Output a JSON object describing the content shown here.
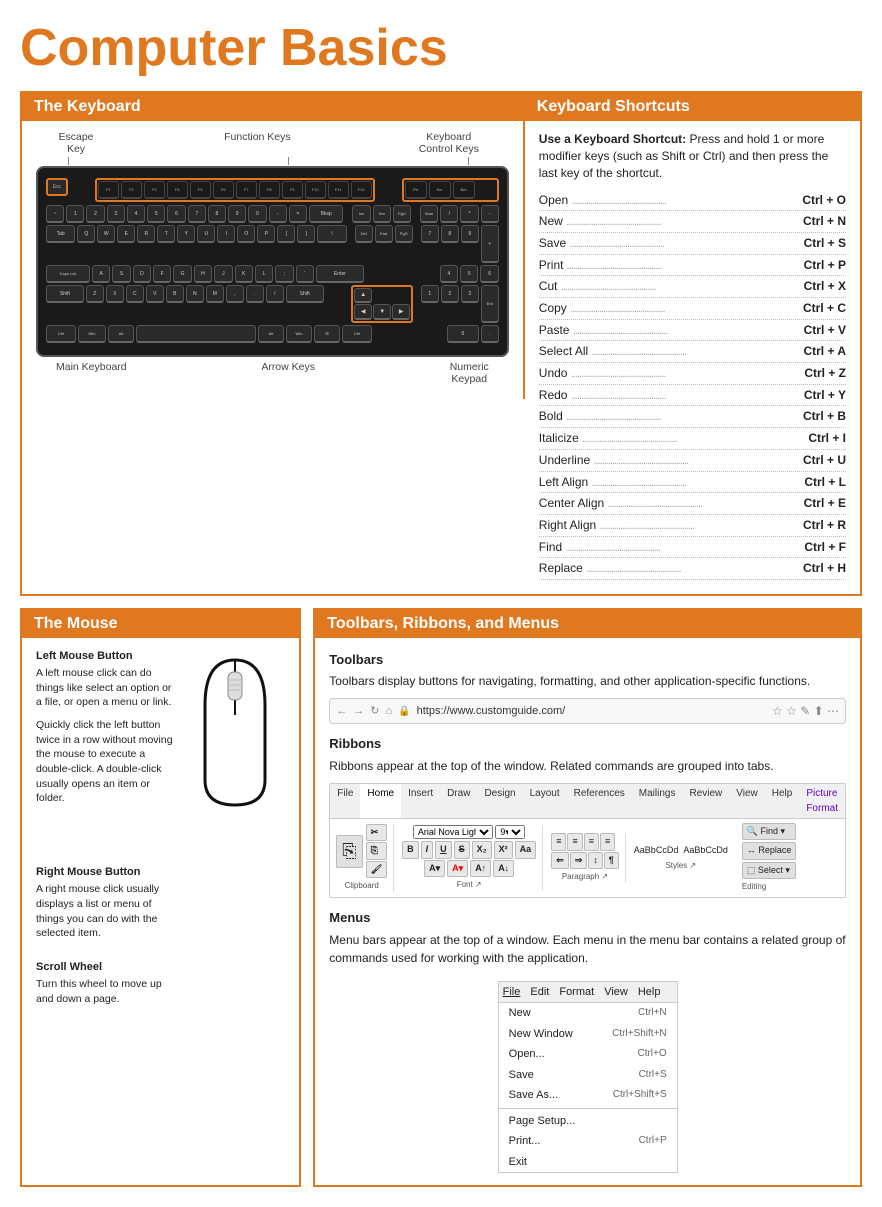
{
  "page": {
    "title": "Computer Basics"
  },
  "keyboard_section": {
    "header_left": "The Keyboard",
    "header_right": "Keyboard Shortcuts",
    "labels": {
      "escape": "Escape\nKey",
      "function": "Function Keys",
      "control": "Keyboard\nControl Keys",
      "main": "Main Keyboard",
      "arrows": "Arrow Keys",
      "numpad": "Numeric\nKeypad"
    },
    "shortcuts_intro": {
      "bold": "Use a Keyboard Shortcut:",
      "text": " Press and hold 1 or more modifier keys (such as Shift or Ctrl) and then press the last key of the shortcut."
    },
    "shortcuts": [
      {
        "name": "Open",
        "keys": "Ctrl + O"
      },
      {
        "name": "New",
        "keys": "Ctrl + N"
      },
      {
        "name": "Save",
        "keys": "Ctrl + S"
      },
      {
        "name": "Print",
        "keys": "Ctrl + P"
      },
      {
        "name": "Cut",
        "keys": "Ctrl + X"
      },
      {
        "name": "Copy",
        "keys": "Ctrl + C"
      },
      {
        "name": "Paste",
        "keys": "Ctrl + V"
      },
      {
        "name": "Select All",
        "keys": "Ctrl + A"
      },
      {
        "name": "Undo",
        "keys": "Ctrl + Z"
      },
      {
        "name": "Redo",
        "keys": "Ctrl + Y"
      },
      {
        "name": "Bold",
        "keys": "Ctrl + B"
      },
      {
        "name": "Italicize",
        "keys": "Ctrl + I"
      },
      {
        "name": "Underline",
        "keys": "Ctrl + U"
      },
      {
        "name": "Left Align",
        "keys": "Ctrl + L"
      },
      {
        "name": "Center Align",
        "keys": "Ctrl + E"
      },
      {
        "name": "Right Align",
        "keys": "Ctrl + R"
      },
      {
        "name": "Find",
        "keys": "Ctrl + F"
      },
      {
        "name": "Replace",
        "keys": "Ctrl + H"
      }
    ]
  },
  "mouse_section": {
    "header": "The Mouse",
    "left_button": {
      "title": "Left Mouse Button",
      "desc1": "A left mouse click can do things like select an option or a file, or open a menu or link.",
      "desc2": "Quickly click the left button twice in a row without moving the mouse to execute a double-click. A double-click usually opens an item or folder."
    },
    "right_button": {
      "title": "Right Mouse Button",
      "desc": "A right mouse click usually displays a list or menu of things you can do with the selected item."
    },
    "scroll_wheel": {
      "title": "Scroll Wheel",
      "desc": "Turn this wheel to move up and down a page."
    }
  },
  "toolbars_section": {
    "header": "Toolbars, Ribbons, and Menus",
    "toolbars": {
      "title": "Toolbars",
      "desc": "Toolbars display buttons for navigating, formatting, and other application-specific functions.",
      "url": "https://www.customguide.com/"
    },
    "ribbons": {
      "title": "Ribbons",
      "desc": "Ribbons appear at the top of the window. Related commands are grouped into tabs.",
      "tabs": [
        "File",
        "Home",
        "Insert",
        "Draw",
        "Design",
        "Layout",
        "References",
        "Mailings",
        "Review",
        "View",
        "Help",
        "Picture Format"
      ]
    },
    "menus": {
      "title": "Menus",
      "desc": "Menu bars appear at the top of a window. Each menu in the menu bar contains a related group of commands used for working with the application.",
      "bar": [
        "File",
        "Edit",
        "Format",
        "View",
        "Help"
      ],
      "items": [
        {
          "label": "New",
          "shortcut": "Ctrl+N"
        },
        {
          "label": "New Window",
          "shortcut": "Ctrl+Shift+N"
        },
        {
          "label": "Open...",
          "shortcut": "Ctrl+O"
        },
        {
          "label": "Save",
          "shortcut": "Ctrl+S"
        },
        {
          "label": "Save As...",
          "shortcut": "Ctrl+Shift+S"
        },
        {
          "label": "separator"
        },
        {
          "label": "Page Setup...",
          "shortcut": ""
        },
        {
          "label": "Print...",
          "shortcut": "Ctrl+P"
        },
        {
          "label": "Exit",
          "shortcut": ""
        }
      ]
    }
  },
  "colors": {
    "orange": "#E07820",
    "dark": "#1a1a1a",
    "mid": "#2a2a2a"
  }
}
